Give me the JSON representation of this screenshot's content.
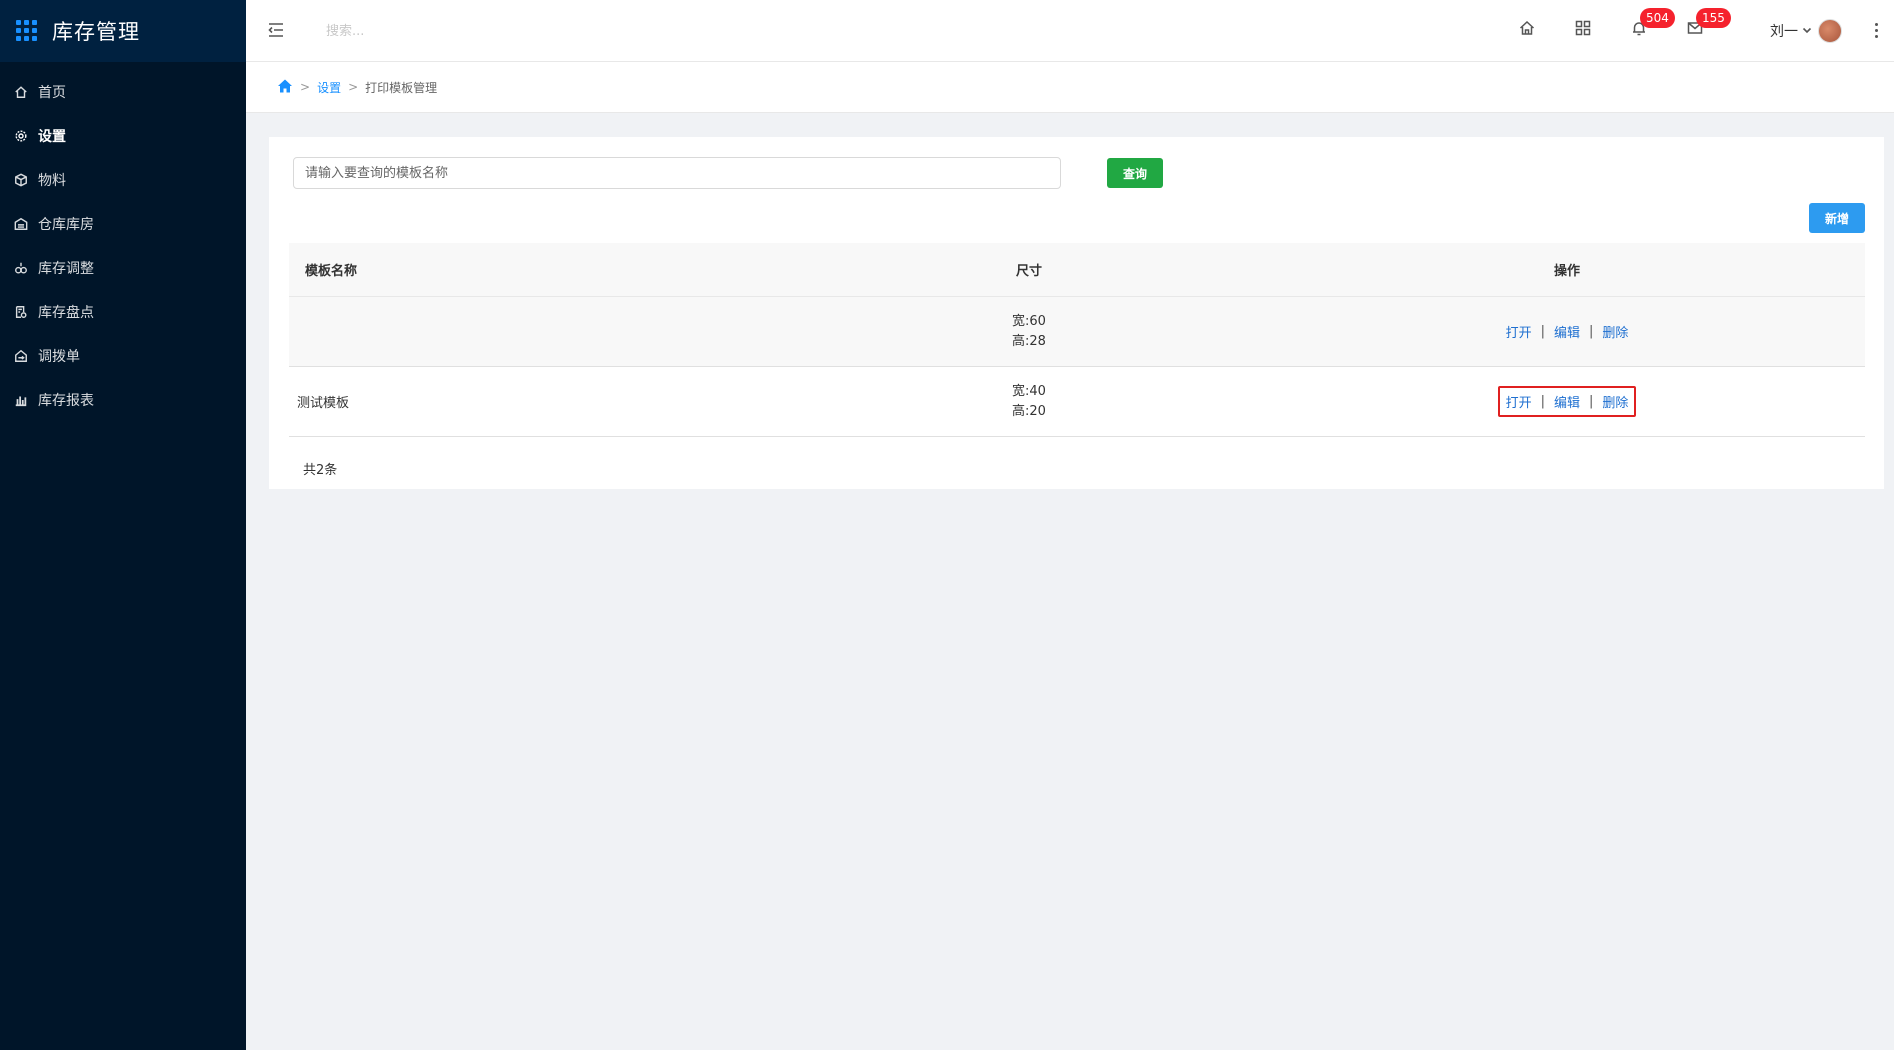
{
  "app": {
    "title": "库存管理"
  },
  "sidebar": {
    "items": [
      {
        "label": "首页",
        "icon": "home-icon"
      },
      {
        "label": "设置",
        "icon": "gear-icon"
      },
      {
        "label": "物料",
        "icon": "cube-icon"
      },
      {
        "label": "仓库库房",
        "icon": "warehouse-icon"
      },
      {
        "label": "库存调整",
        "icon": "adjust-icon"
      },
      {
        "label": "库存盘点",
        "icon": "inventory-check-icon"
      },
      {
        "label": "调拨单",
        "icon": "transfer-icon"
      },
      {
        "label": "库存报表",
        "icon": "bar-chart-icon"
      }
    ],
    "active_index": 1
  },
  "header": {
    "search_placeholder": "搜索...",
    "notifications_count": "504",
    "messages_count": "155",
    "user_name": "刘一"
  },
  "breadcrumb": {
    "link": "设置",
    "current": "打印模板管理",
    "separator": ">"
  },
  "toolbar": {
    "query_placeholder": "请输入要查询的模板名称",
    "query_label": "查询",
    "add_label": "新增"
  },
  "table": {
    "columns": [
      "模板名称",
      "尺寸",
      "操作"
    ],
    "rows": [
      {
        "name": "",
        "width": "宽:60",
        "height": "高:28"
      },
      {
        "name": "测试模板",
        "width": "宽:40",
        "height": "高:20"
      }
    ],
    "actions": {
      "open": "打开",
      "edit": "编辑",
      "delete": "删除",
      "separator": "|"
    },
    "total_text": "共2条"
  },
  "colors": {
    "sidebar_bg": "#001529",
    "accent": "#1890ff",
    "query_button": "#21a843",
    "add_button": "#2d9bf0",
    "badge": "#f5222d",
    "highlight_border": "#e02020"
  }
}
